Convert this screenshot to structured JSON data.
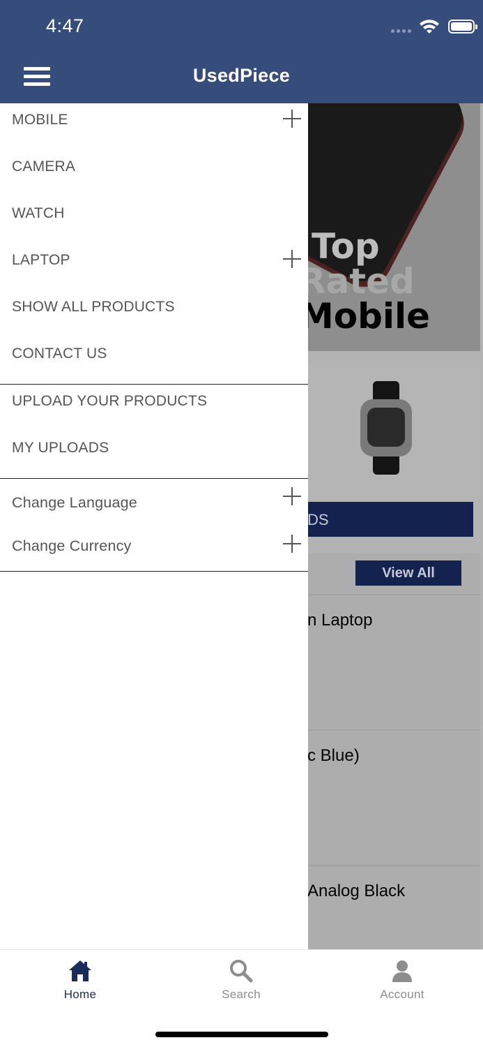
{
  "status_bar": {
    "time": "4:47"
  },
  "header": {
    "title": "UsedPiece",
    "menu_icon": "hamburger-icon"
  },
  "drawer": {
    "items": [
      {
        "label": "MOBILE",
        "expandable": true
      },
      {
        "label": "CAMERA",
        "expandable": false
      },
      {
        "label": "WATCH",
        "expandable": false
      },
      {
        "label": "LAPTOP",
        "expandable": true
      },
      {
        "label": "SHOW ALL PRODUCTS",
        "expandable": false
      },
      {
        "label": "CONTACT US",
        "expandable": false
      }
    ],
    "user_items": [
      {
        "label": "UPLOAD YOUR PRODUCTS"
      },
      {
        "label": "MY UPLOADS"
      }
    ],
    "settings_items": [
      {
        "label": "Change Language",
        "expandable": true
      },
      {
        "label": "Change Currency",
        "expandable": true
      }
    ]
  },
  "background": {
    "banner": {
      "line1": "Top",
      "line2": "Rated",
      "line3": "Mobile"
    },
    "brands_bar_label": "DS",
    "view_all_label": "View All",
    "products": [
      {
        "name": "n Laptop"
      },
      {
        "name": "c Blue)"
      },
      {
        "name": "Analog Black"
      }
    ]
  },
  "tabbar": {
    "tabs": [
      {
        "label": "Home",
        "icon": "home-icon",
        "active": true
      },
      {
        "label": "Search",
        "icon": "search-icon",
        "active": false
      },
      {
        "label": "Account",
        "icon": "account-icon",
        "active": false
      }
    ]
  },
  "colors": {
    "header_bg": "#364d7c",
    "accent_navy": "#142250",
    "active_tab": "#1b2b5a",
    "inactive_tab": "#8d8d8d",
    "drawer_text": "#555555"
  }
}
